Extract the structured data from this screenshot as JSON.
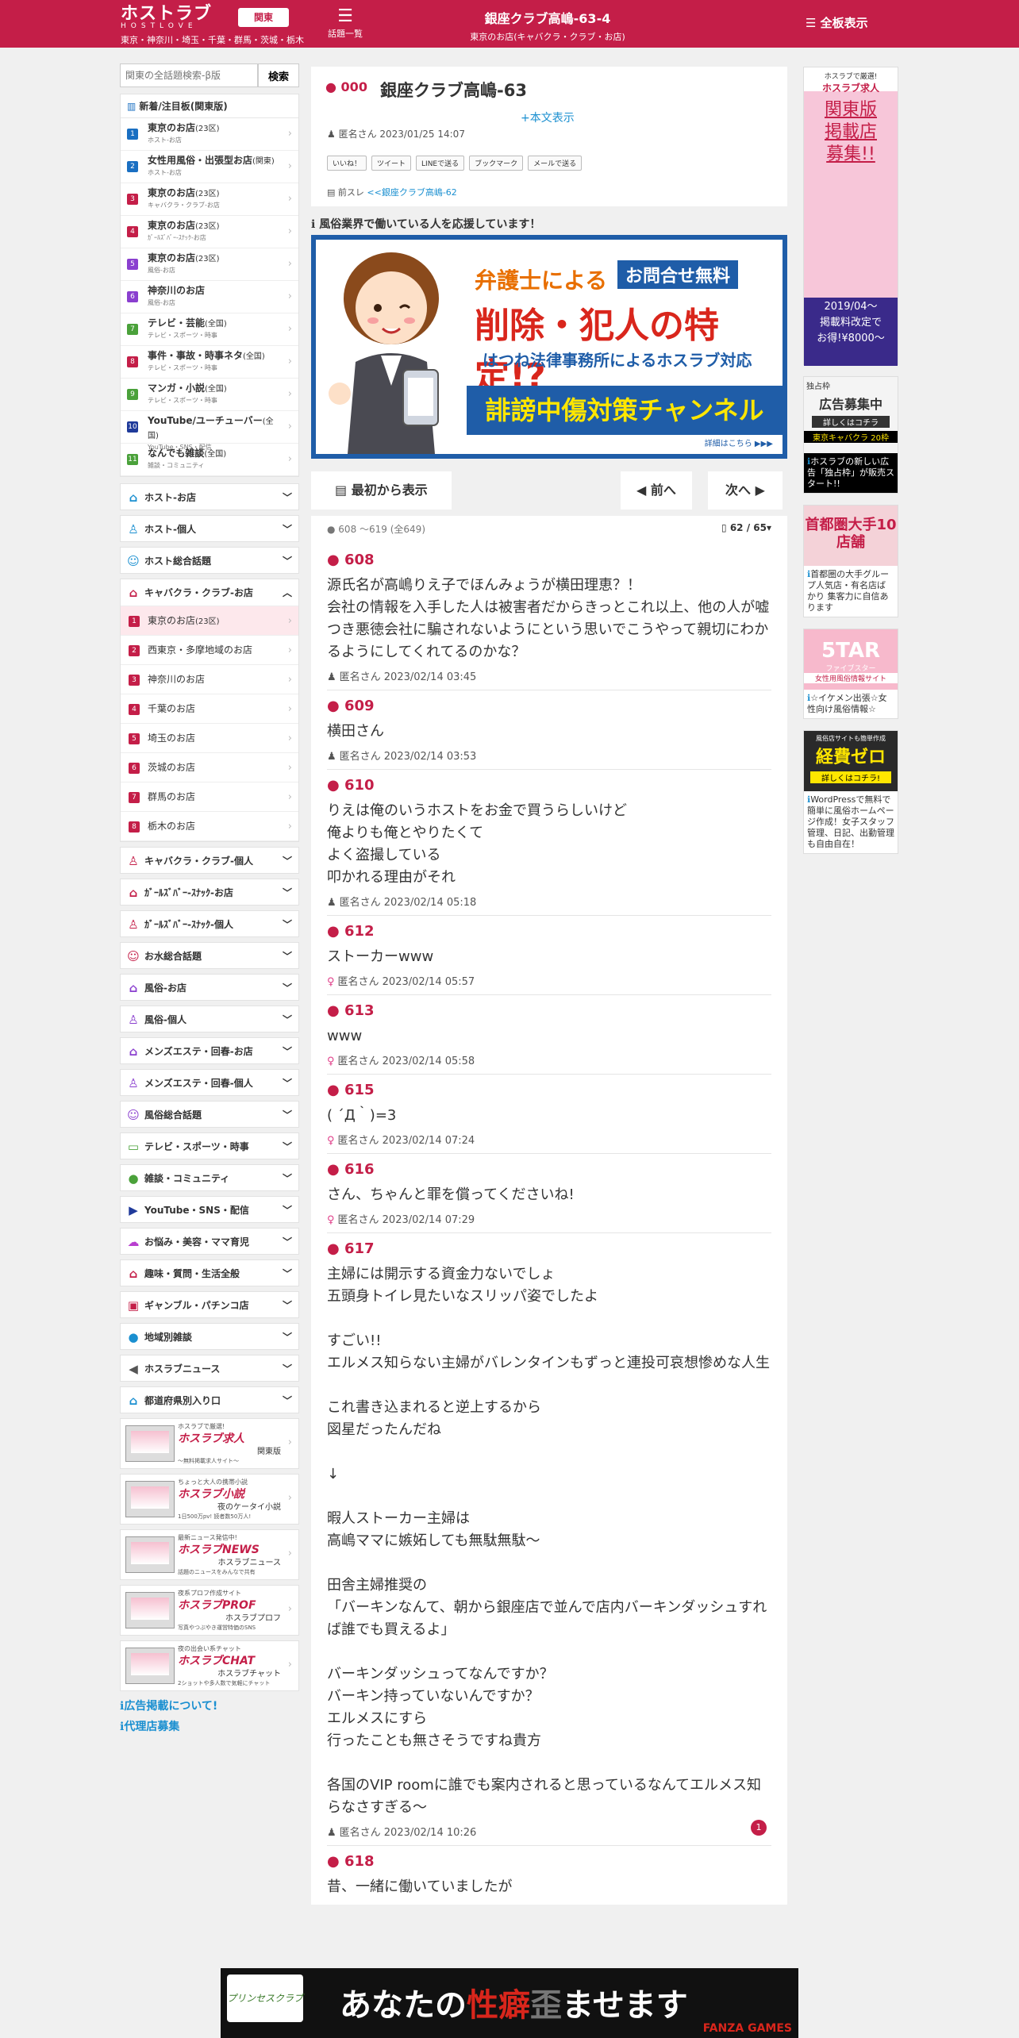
{
  "header": {
    "logo": "ホストラブ",
    "logo_sub": "HOSTLOVE",
    "logo_area": "東京・神奈川・埼玉・千葉・群馬・茨城・栃木",
    "region": "関東",
    "topics_list": "話題一覧",
    "title": "銀座クラブ高嶋-63-4",
    "subtitle": "東京のお店(キャバクラ・クラブ・お店)",
    "right": "全板表示"
  },
  "sidebar": {
    "search_placeholder": "関東の全話題検索-β版",
    "search_button": "検索",
    "new_box_title": "新着/注目板(関東版)",
    "new_items": [
      {
        "num": "1",
        "name": "東京のお店",
        "tag": "(23区)",
        "sub": "ホスト-お店",
        "color": "#1a6fc2"
      },
      {
        "num": "2",
        "name": "女性用風俗・出張型お店",
        "tag": "(関東)",
        "sub": "ホスト-お店",
        "color": "#1a6fc2"
      },
      {
        "num": "3",
        "name": "東京のお店",
        "tag": "(23区)",
        "sub": "キャバクラ・クラブ-お店",
        "color": "#c41e48"
      },
      {
        "num": "4",
        "name": "東京のお店",
        "tag": "(23区)",
        "sub": "ｶﾞｰﾙｽﾞﾊﾞｰ-ｽﾅｯｸ-お店",
        "color": "#c41e48"
      },
      {
        "num": "5",
        "name": "東京のお店",
        "tag": "(23区)",
        "sub": "風俗-お店",
        "color": "#8a3fcf"
      },
      {
        "num": "6",
        "name": "神奈川のお店",
        "tag": "",
        "sub": "風俗-お店",
        "color": "#8a3fcf"
      },
      {
        "num": "7",
        "name": "テレビ・芸能",
        "tag": "(全国)",
        "sub": "テレビ・スポーツ・時事",
        "color": "#4aa13a"
      },
      {
        "num": "8",
        "name": "事件・事故・時事ネタ",
        "tag": "(全国)",
        "sub": "テレビ・スポーツ・時事",
        "color": "#c41e48"
      },
      {
        "num": "9",
        "name": "マンガ・小説",
        "tag": "(全国)",
        "sub": "テレビ・スポーツ・時事",
        "color": "#4aa13a"
      },
      {
        "num": "10",
        "name": "YouTube/ユーチューバー",
        "tag": "(全国)",
        "sub": "YouTube・SNS・配信",
        "color": "#1f3a9a"
      },
      {
        "num": "11",
        "name": "なんでも雑談",
        "tag": "(全国)",
        "sub": "雑談・コミュニティ",
        "color": "#4aa13a"
      }
    ],
    "menu_top": [
      {
        "label": "ホスト-お店",
        "icon": "⌂",
        "color": "#1a8fd0"
      },
      {
        "label": "ホスト-個人",
        "icon": "♙",
        "color": "#1a8fd0"
      },
      {
        "label": "ホスト総合話題",
        "icon": "☺",
        "color": "#1a8fd0"
      }
    ],
    "open_menu": {
      "label": "キャバクラ・クラブ-お店",
      "icon": "⌂",
      "color": "#c41e48"
    },
    "open_items": [
      {
        "num": "1",
        "label": "東京のお店",
        "tag": "(23区)"
      },
      {
        "num": "2",
        "label": "西東京・多摩地域のお店",
        "tag": ""
      },
      {
        "num": "3",
        "label": "神奈川のお店",
        "tag": ""
      },
      {
        "num": "4",
        "label": "千葉のお店",
        "tag": ""
      },
      {
        "num": "5",
        "label": "埼玉のお店",
        "tag": ""
      },
      {
        "num": "6",
        "label": "茨城のお店",
        "tag": ""
      },
      {
        "num": "7",
        "label": "群馬のお店",
        "tag": ""
      },
      {
        "num": "8",
        "label": "栃木のお店",
        "tag": ""
      }
    ],
    "menu_bottom": [
      {
        "label": "キャバクラ・クラブ-個人",
        "icon": "♙",
        "color": "#c41e48"
      },
      {
        "label": "ｶﾞｰﾙｽﾞﾊﾞｰ-ｽﾅｯｸ-お店",
        "icon": "⌂",
        "color": "#c41e48"
      },
      {
        "label": "ｶﾞｰﾙｽﾞﾊﾞｰ-ｽﾅｯｸ-個人",
        "icon": "♙",
        "color": "#c41e48"
      },
      {
        "label": "お水総合話題",
        "icon": "☺",
        "color": "#c41e48"
      },
      {
        "label": "風俗-お店",
        "icon": "⌂",
        "color": "#8a3fcf"
      },
      {
        "label": "風俗-個人",
        "icon": "♙",
        "color": "#8a3fcf"
      },
      {
        "label": "メンズエステ・回春-お店",
        "icon": "⌂",
        "color": "#8a3fcf"
      },
      {
        "label": "メンズエステ・回春-個人",
        "icon": "♙",
        "color": "#8a3fcf"
      },
      {
        "label": "風俗総合話題",
        "icon": "☺",
        "color": "#8a3fcf"
      },
      {
        "label": "テレビ・スポーツ・時事",
        "icon": "▭",
        "color": "#4aa13a"
      },
      {
        "label": "雑談・コミュニティ",
        "icon": "●",
        "color": "#4aa13a"
      },
      {
        "label": "YouTube・SNS・配信",
        "icon": "▶",
        "color": "#1f3a9a"
      },
      {
        "label": "お悩み・美容・ママ育児",
        "icon": "☁",
        "color": "#b83fcf"
      },
      {
        "label": "趣味・質問・生活全般",
        "icon": "⌂",
        "color": "#c41e48"
      },
      {
        "label": "ギャンブル・パチンコ店",
        "icon": "▣",
        "color": "#c41e48"
      },
      {
        "label": "地域別雑談",
        "icon": "●",
        "color": "#1a8fd0"
      },
      {
        "label": "ホスラブニュース",
        "icon": "◀",
        "color": "#555555"
      },
      {
        "label": "都道府県別入り口",
        "icon": "⌂",
        "color": "#1a8fd0"
      }
    ],
    "banners": [
      {
        "t1": "ホスラブで厳選!",
        "t2": "ホスラブ求人",
        "t3": "関東版",
        "t4": "〜無料掲載求人サイト〜"
      },
      {
        "t1": "ちょっと大人の携帯小説",
        "t2": "ホスラブ小説",
        "t3": "夜のケータイ小説",
        "t4": "1日500万pv! 読者数50万人!"
      },
      {
        "t1": "最新ニュース発信中!",
        "t2": "ホスラブNEWS",
        "t3": "ホスラブニュース",
        "t4": "話題のニュースをみんなで共有"
      },
      {
        "t1": "夜系プロフ作成サイト",
        "t2": "ホスラブPROF",
        "t3": "ホスラブプロフ",
        "t4": "写真やつぶやき運営特価のSNS"
      },
      {
        "t1": "夜の出会い系チャット",
        "t2": "ホスラブCHAT",
        "t3": "ホスラブチャット",
        "t4": "2ショットや多人数で気軽にチャット"
      }
    ],
    "links": [
      "広告掲載について!",
      "代理店募集"
    ]
  },
  "thread": {
    "num": "000",
    "title": "銀座クラブ高嶋-63",
    "more": "+本文表示",
    "meta": "匿名さん 2023/01/25 14:07",
    "share": [
      "いいね！",
      "ツイート",
      "LINEで送る",
      "ブックマーク",
      "メールで送る"
    ],
    "prev_label": "前スレ",
    "prev_link": "<<銀座クラブ高嶋-62"
  },
  "support_text": "風俗業界で働いている人を応援しています！",
  "ad": {
    "t1": "弁護士による",
    "t1b": "お問合せ無料",
    "t2": "削除・犯人の特定!?",
    "t3": "はつね法律事務所によるホスラブ対応",
    "t4": "誹謗中傷対策チャンネル",
    "detail": "詳細はこちら ▶▶▶"
  },
  "nav": {
    "first": "最初から表示",
    "prev": "前へ",
    "next": "次へ"
  },
  "posts_info": {
    "range": "608 ～619 (全649)",
    "page": "62 / 65"
  },
  "posts": [
    {
      "num": "608",
      "body": "源氏名が高嶋りえ子でほんみょうが横田理恵？！\n会社の情報を入手した人は被害者だからきっとこれ以上、他の人が嘘つき悪徳会社に騙されないようにという思いでこうやって親切にわかるようにしてくれてるのかな？",
      "meta": "匿名さん 2023/02/14 03:45",
      "female": false,
      "badge": ""
    },
    {
      "num": "609",
      "body": "横田さん",
      "meta": "匿名さん 2023/02/14 03:53",
      "female": false,
      "badge": ""
    },
    {
      "num": "610",
      "body": "りえは俺のいうホストをお金で買うらしいけど\n俺よりも俺とやりたくて\nよく盗撮している\n叩かれる理由がそれ",
      "meta": "匿名さん 2023/02/14 05:18",
      "female": false,
      "badge": ""
    },
    {
      "num": "612",
      "body": "ストーカーwww",
      "meta": "匿名さん 2023/02/14 05:57",
      "female": true,
      "badge": ""
    },
    {
      "num": "613",
      "body": "www",
      "meta": "匿名さん 2023/02/14 05:58",
      "female": true,
      "badge": ""
    },
    {
      "num": "615",
      "body": "( ´Д｀)=3",
      "meta": "匿名さん 2023/02/14 07:24",
      "female": true,
      "badge": ""
    },
    {
      "num": "616",
      "body": "さん、ちゃんと罪を償ってくださいね!",
      "meta": "匿名さん 2023/02/14 07:29",
      "female": true,
      "badge": ""
    },
    {
      "num": "617",
      "body": "主婦には開示する資金力ないでしょ\n五頭身トイレ見たいなスリッパ姿でしたよ\n\nすごい!!\nエルメス知らない主婦がバレンタインもずっと連投可哀想惨めな人生\n\nこれ書き込まれると逆上するから\n図星だったんだね\n\n↓\n\n暇人ストーカー主婦は\n高嶋ママに嫉妬しても無駄無駄〜\n\n田舎主婦推奨の\n「バーキンなんて、朝から銀座店で並んで店内バーキンダッシュすれば誰でも買えるよ」\n\nバーキンダッシュってなんですか？\nバーキン持っていないんですか？\nエルメスにすら\n行ったことも無さそうですね貴方\n\n各国のVIP roomに誰でも案内されると思っているなんてエルメス知らなさすぎる〜",
      "meta": "匿名さん 2023/02/14 10:26",
      "female": false,
      "badge": "1"
    },
    {
      "num": "618",
      "body": "昔、一緒に働いていましたが",
      "meta": "",
      "female": false,
      "badge": ""
    }
  ],
  "right_ads": [
    {
      "top": "ホスラブで厳選!",
      "brand": "ホスラブ求人",
      "big": "関東版\n掲載店\n募集!!",
      "bottom": "2019/04〜\n掲載料改定で\nお得!¥8000〜",
      "caption": ""
    },
    {
      "top": "独占枠",
      "brand": "広告募集中",
      "big": "詳しくはコチラ",
      "bottom": "東京キャバクラ 20枠",
      "caption": "ホスラブの新しい広告「独占枠」が販売スタート!!"
    },
    {
      "top": "",
      "brand": "首都圏大手10店舗",
      "big": "",
      "bottom": "",
      "caption": "首都圏の大手グループ人気店・有名店ばかり 集客力に自信あります"
    },
    {
      "top": "",
      "brand": "5TAR",
      "big": "ファイブスター",
      "bottom": "女性用風俗情報サイト",
      "caption": "☆イケメン出張☆女性向け風俗情報☆"
    },
    {
      "top": "風俗店サイトも簡単作成",
      "brand": "経費ゼロ",
      "big": "詳しくはコチラ!",
      "bottom": "",
      "caption": "WordPressで無料で簡単に風俗ホームページ作成！女子スタッフ管理、日記、出勤管理も自由自在！"
    }
  ],
  "bottom_ad": {
    "left": "プリンセスクラブ",
    "pre": "あなたの",
    "red": "性癖",
    "mid": "歪",
    "post": "ませます",
    "brand": "FANZA GAMES"
  }
}
